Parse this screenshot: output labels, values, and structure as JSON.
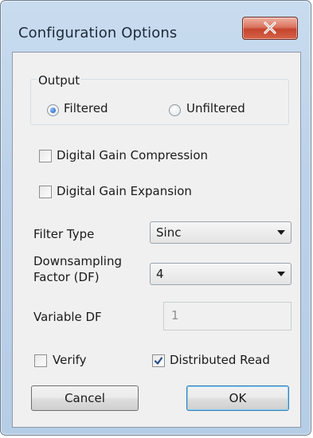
{
  "window": {
    "title": "Configuration Options"
  },
  "output_group": {
    "label": "Output",
    "options": [
      "Filtered",
      "Unfiltered"
    ],
    "selected": "Filtered"
  },
  "checkboxes": {
    "gain_compression": {
      "label": "Digital Gain Compression",
      "checked": false
    },
    "gain_expansion": {
      "label": "Digital Gain Expansion",
      "checked": false
    },
    "verify": {
      "label": "Verify",
      "checked": false
    },
    "distributed_read": {
      "label": "Distributed Read",
      "checked": true
    }
  },
  "filter_type": {
    "label": "Filter Type",
    "value": "Sinc"
  },
  "downsampling": {
    "label_line1": "Downsampling",
    "label_line2": "Factor (DF)",
    "value": "4"
  },
  "variable_df": {
    "label": "Variable DF",
    "value": "1",
    "enabled": false
  },
  "buttons": {
    "cancel": "Cancel",
    "ok": "OK"
  }
}
